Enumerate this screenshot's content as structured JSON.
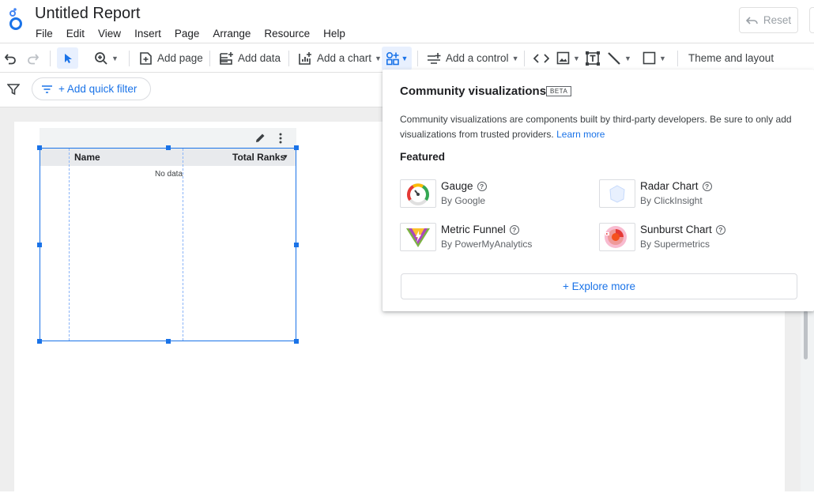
{
  "header": {
    "title": "Untitled Report",
    "menu": [
      "File",
      "Edit",
      "View",
      "Insert",
      "Page",
      "Arrange",
      "Resource",
      "Help"
    ],
    "reset_label": "Reset"
  },
  "toolbar": {
    "add_page": "Add page",
    "add_data": "Add data",
    "add_chart": "Add a chart",
    "add_control": "Add a control",
    "theme_layout": "Theme and layout"
  },
  "filterbar": {
    "quick_filter": "+ Add quick filter"
  },
  "table": {
    "columns": [
      "Name",
      "Total Ranks"
    ],
    "sort_indicator": "▾",
    "empty_text": "No data"
  },
  "popup": {
    "title": "Community visualizations",
    "badge": "BETA",
    "description": "Community visualizations are components built by third-party developers. Be sure to only add visualizations from trusted providers.",
    "learn_more": "Learn more",
    "featured_label": "Featured",
    "items": [
      {
        "name": "Gauge",
        "by": "By Google"
      },
      {
        "name": "Radar Chart",
        "by": "By ClickInsight"
      },
      {
        "name": "Metric Funnel",
        "by": "By PowerMyAnalytics"
      },
      {
        "name": "Sunburst Chart",
        "by": "By Supermetrics"
      }
    ],
    "explore_more": "+ Explore more"
  },
  "colors": {
    "accent": "#1a73e8",
    "selected_tool_bg": "#e8f0fe"
  }
}
